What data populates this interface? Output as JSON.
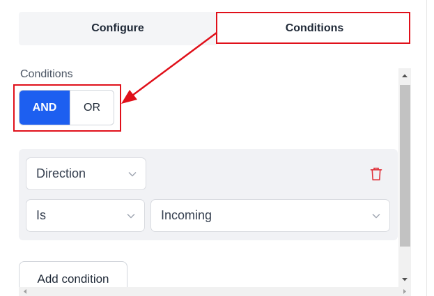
{
  "tabs": [
    {
      "label": "Configure",
      "active": false
    },
    {
      "label": "Conditions",
      "active": true
    }
  ],
  "conditions": {
    "section_label": "Conditions",
    "logic_toggle": {
      "options": [
        "AND",
        "OR"
      ],
      "selected": "AND"
    },
    "rows": {
      "field_select": "Direction",
      "operator_select": "Is",
      "value_select": "Incoming"
    },
    "add_condition_label": "Add condition"
  },
  "colors": {
    "accent": "#1d5ff0",
    "annotation": "#e0101a",
    "delete": "#e0323b"
  },
  "icons": [
    "chevron-down-icon",
    "trash-icon",
    "scroll-up-icon",
    "scroll-down-icon",
    "scroll-left-icon",
    "scroll-right-icon"
  ]
}
